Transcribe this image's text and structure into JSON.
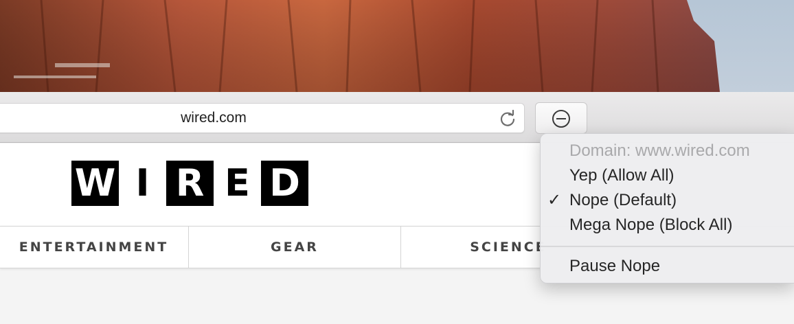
{
  "browser": {
    "address": "wired.com",
    "reload_icon": "reload-icon",
    "extension_icon": "minus-circle-icon"
  },
  "site": {
    "logo_letters": [
      "W",
      "I",
      "R",
      "E",
      "D"
    ],
    "nav": [
      "ENTERTAINMENT",
      "GEAR",
      "SCIENCE"
    ]
  },
  "menu": {
    "domain": "Domain: www.wired.com",
    "items": [
      {
        "label": "Yep (Allow All)",
        "checked": false
      },
      {
        "label": "Nope (Default)",
        "checked": true
      },
      {
        "label": "Mega Nope (Block All)",
        "checked": false
      }
    ],
    "check_mark": "✓",
    "pause": "Pause Nope"
  }
}
